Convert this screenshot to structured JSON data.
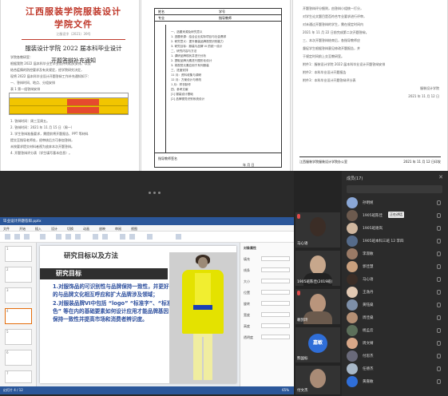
{
  "doc1": {
    "school": "江西服装学院服装设计学院文件",
    "doc_no": "江服设字〔2021〕39号",
    "title": "服装设计学院 2022 届本科毕业设计",
    "subtitle": "开题答辩补充通知",
    "lines": [
      "学院各教研室：",
      "根据我院 2022 届本科毕业生毕业设计的相关安排，以及",
      "结合疫情的防控要求及有关规定，经学院研究决定，",
      "现将 2022 届本科毕业设计开题答辩工作补充通知如下：",
      "一、答辩时间、地点、分组安排",
      "表 1 第一组答辩安排",
      "1. 答辩时间：周三至周五。",
      "2. 答辩时间：2021 年 11 月 15 日（周一）",
      "3. 学生答辩准备要求，需提前将开题报告、PPT 等材料",
      "提交至指导老师处，经审核后方可参加答辩，",
      "未按要求提交材料者视为放弃本次开题答辩。",
      "4. 开题答辩评分表（学生填写基本信息）。"
    ]
  },
  "doc2": {
    "labels": [
      "姓名",
      "学号",
      "专业",
      "指导教师"
    ],
    "lines": [
      "一、选题来源及研究意义",
      "1. 选题来源：结合企业实际项目与社会需求",
      "2. 研究意义：提升服装品牌视觉识别能力",
      "3. 研究目标：服装与品牌 VI 的统一设计",
      "二、研究内容与方法",
      "1. 调研品牌现状并进行分析",
      "2. 提取品牌元素进行图形化设计",
      "3. 将视觉元素应用于系列服装",
      "三、进度安排",
      "11 月：资料收集与调研",
      "12 月：方案设计与修改",
      "1 月：样衣制作",
      "四、参考文献",
      "[1] 服装设计基础",
      "[2] 品牌视觉识别系统设计"
    ],
    "sign_label": "指导教师签名",
    "date_label": "年 月 日"
  },
  "doc3": {
    "lines": [
      "开题答辩评分细则，由答辩小组统一打分，",
      "对学生论文题目是否符合专业要求进行评审，",
      "对未通过开题答辩的学生，需在规定时间内",
      "2021 年 11 月 22 日前完成第二次开题答辩。",
      "三、本次开题答辩结束后，各指导教师应",
      "督促学生根据答辩意见修改开题报告，并",
      "于规定时间前上交至教研室。",
      "附件1：服装设计学院 2022 届本科毕业设计开题答辩安排",
      "附件2：本科毕业设计开题报告",
      "附件3：本科毕业设计开题答辩评分表",
      "服装设计学院",
      "2021 年 11 月 12 日"
    ],
    "footer_left": "江西服装学院服装设计学院办公室",
    "footer_right": "2021 年 11 月 12 日印发"
  },
  "ppt": {
    "window_title": "毕业设计开题答辩.pptx",
    "menu": [
      "文件",
      "开始",
      "插入",
      "设计",
      "切换",
      "动画",
      "放映",
      "审阅",
      "视图"
    ],
    "slide_title": "研究目标以及方法",
    "slide_subtitle": "研究目标",
    "body": [
      "1.对服饰品的可识别性与品牌保持一致性，并更好的与品牌文化相互呼应和扩大品牌涉及领域；",
      "2.对服装品牌VI中包括 “logo” “标准字”、“标准色” 等在内的基础要素如何设计应用才能品牌基因保持一致性并提高市场和消费者辨识度。"
    ],
    "props_labels": [
      "对象属性",
      "填充",
      "线条",
      "大小",
      "位置",
      "旋转",
      "宽度",
      "高度",
      "透明度"
    ],
    "status_left": "幻灯片 4 / 12",
    "status_right": "65%"
  },
  "videos": [
    {
      "label": "马心语",
      "type": "face"
    },
    {
      "label": "1905班陈佳(2019班)",
      "type": "face"
    },
    {
      "label": "赖凯玲",
      "type": "face"
    },
    {
      "label": "熊国标",
      "type": "avatar",
      "initials": "嘉敏"
    },
    {
      "label": "付文杰",
      "type": "face"
    }
  ],
  "members": {
    "title": "成员(17)",
    "close": "✕",
    "badge": "正在讲话",
    "items": [
      "孙明姬",
      "1905班陈佳",
      "1905班谢岚",
      "1905班本科三班 12 李四",
      "李淑敏",
      "郭佳慧",
      "马心语",
      "王逸丹",
      "黄钰燊",
      "周佳燊",
      "杨孟云",
      "周文婧",
      "付思杰",
      "任德杰",
      "黄嘉敏",
      "付文杰",
      "陈贺"
    ]
  }
}
